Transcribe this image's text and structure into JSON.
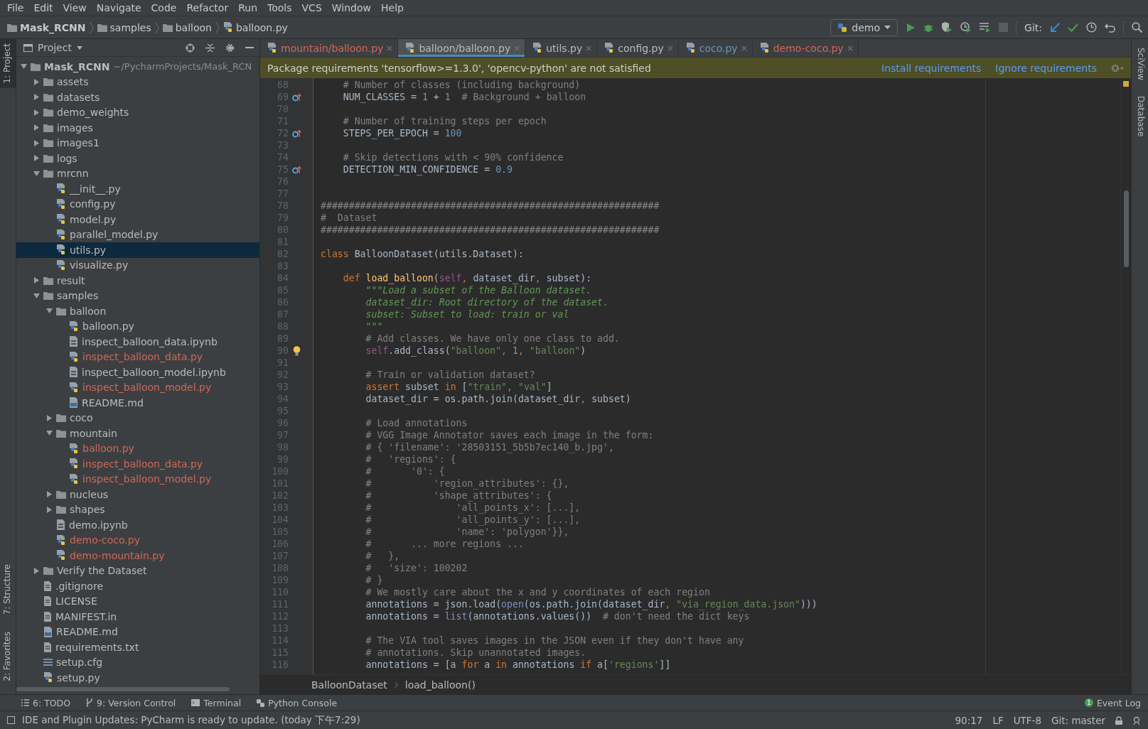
{
  "menu": [
    "File",
    "Edit",
    "View",
    "Navigate",
    "Code",
    "Refactor",
    "Run",
    "Tools",
    "VCS",
    "Window",
    "Help"
  ],
  "navbar": {
    "breadcrumbs": [
      {
        "label": "Mask_RCNN",
        "kind": "project"
      },
      {
        "label": "samples",
        "kind": "folder"
      },
      {
        "label": "balloon",
        "kind": "folder"
      },
      {
        "label": "balloon.py",
        "kind": "python"
      }
    ],
    "run_config": "demo",
    "git_label": "Git:"
  },
  "left_stripe": {
    "top": [
      {
        "label": "1: Project",
        "selected": true
      }
    ],
    "bottom": [
      {
        "label": "7: Structure",
        "selected": false
      },
      {
        "label": "2: Favorites",
        "selected": false
      }
    ]
  },
  "right_stripe": [
    "SciView",
    "Database"
  ],
  "project": {
    "title": "Project",
    "tree": [
      {
        "label": "Mask_RCNN",
        "path": "~/PycharmProjects/Mask_RCN",
        "kind": "folder",
        "expanded": true,
        "selected": false,
        "untracked": false,
        "children": [
          {
            "label": "assets",
            "kind": "folder",
            "expanded": false,
            "selected": false,
            "untracked": false
          },
          {
            "label": "datasets",
            "kind": "folder",
            "expanded": false,
            "selected": false,
            "untracked": false
          },
          {
            "label": "demo_weights",
            "kind": "folder",
            "expanded": false,
            "selected": false,
            "untracked": false
          },
          {
            "label": "images",
            "kind": "folder",
            "expanded": false,
            "selected": false,
            "untracked": false
          },
          {
            "label": "images1",
            "kind": "folder",
            "expanded": false,
            "selected": false,
            "untracked": false
          },
          {
            "label": "logs",
            "kind": "folder",
            "expanded": false,
            "selected": false,
            "untracked": false
          },
          {
            "label": "mrcnn",
            "kind": "folder",
            "expanded": true,
            "selected": false,
            "untracked": false,
            "children": [
              {
                "label": "__init__.py",
                "kind": "python",
                "selected": false,
                "untracked": false
              },
              {
                "label": "config.py",
                "kind": "python",
                "selected": false,
                "untracked": false
              },
              {
                "label": "model.py",
                "kind": "python",
                "selected": false,
                "untracked": false
              },
              {
                "label": "parallel_model.py",
                "kind": "python",
                "selected": false,
                "untracked": false
              },
              {
                "label": "utils.py",
                "kind": "python",
                "selected": true,
                "untracked": false
              },
              {
                "label": "visualize.py",
                "kind": "python",
                "selected": false,
                "untracked": false
              }
            ]
          },
          {
            "label": "result",
            "kind": "folder",
            "expanded": false,
            "selected": false,
            "untracked": false
          },
          {
            "label": "samples",
            "kind": "folder",
            "expanded": true,
            "selected": false,
            "untracked": false,
            "children": [
              {
                "label": "balloon",
                "kind": "folder",
                "expanded": true,
                "selected": false,
                "untracked": false,
                "children": [
                  {
                    "label": "balloon.py",
                    "kind": "python",
                    "selected": false,
                    "untracked": false
                  },
                  {
                    "label": "inspect_balloon_data.ipynb",
                    "kind": "notebook",
                    "selected": false,
                    "untracked": false
                  },
                  {
                    "label": "inspect_balloon_data.py",
                    "kind": "python",
                    "selected": false,
                    "untracked": true
                  },
                  {
                    "label": "inspect_balloon_model.ipynb",
                    "kind": "notebook",
                    "selected": false,
                    "untracked": false
                  },
                  {
                    "label": "inspect_balloon_model.py",
                    "kind": "python",
                    "selected": false,
                    "untracked": true
                  },
                  {
                    "label": "README.md",
                    "kind": "markdown",
                    "selected": false,
                    "untracked": false
                  }
                ]
              },
              {
                "label": "coco",
                "kind": "folder",
                "expanded": false,
                "selected": false,
                "untracked": false
              },
              {
                "label": "mountain",
                "kind": "folder",
                "expanded": true,
                "selected": false,
                "untracked": false,
                "children": [
                  {
                    "label": "balloon.py",
                    "kind": "python",
                    "selected": false,
                    "untracked": true
                  },
                  {
                    "label": "inspect_balloon_data.py",
                    "kind": "python",
                    "selected": false,
                    "untracked": true
                  },
                  {
                    "label": "inspect_balloon_model.py",
                    "kind": "python",
                    "selected": false,
                    "untracked": true
                  }
                ]
              },
              {
                "label": "nucleus",
                "kind": "folder",
                "expanded": false,
                "selected": false,
                "untracked": false
              },
              {
                "label": "shapes",
                "kind": "folder",
                "expanded": false,
                "selected": false,
                "untracked": false
              },
              {
                "label": "demo.ipynb",
                "kind": "notebook",
                "selected": false,
                "untracked": false
              },
              {
                "label": "demo-coco.py",
                "kind": "python",
                "selected": false,
                "untracked": true
              },
              {
                "label": "demo-mountain.py",
                "kind": "python",
                "selected": false,
                "untracked": true
              }
            ]
          },
          {
            "label": "Verify the Dataset",
            "kind": "folder",
            "expanded": false,
            "selected": false,
            "untracked": false
          },
          {
            "label": ".gitignore",
            "kind": "text",
            "selected": false,
            "untracked": false
          },
          {
            "label": "LICENSE",
            "kind": "text",
            "selected": false,
            "untracked": false
          },
          {
            "label": "MANIFEST.in",
            "kind": "text",
            "selected": false,
            "untracked": false
          },
          {
            "label": "README.md",
            "kind": "markdown",
            "selected": false,
            "untracked": false
          },
          {
            "label": "requirements.txt",
            "kind": "text",
            "selected": false,
            "untracked": false
          },
          {
            "label": "setup.cfg",
            "kind": "config",
            "selected": false,
            "untracked": false
          },
          {
            "label": "setup.py",
            "kind": "python",
            "selected": false,
            "untracked": false
          }
        ]
      }
    ]
  },
  "tabs": [
    {
      "label": "mountain/balloon.py",
      "untracked": true,
      "modified": false,
      "selected": false
    },
    {
      "label": "balloon/balloon.py",
      "untracked": false,
      "modified": false,
      "selected": true
    },
    {
      "label": "utils.py",
      "untracked": false,
      "modified": false,
      "selected": false
    },
    {
      "label": "config.py",
      "untracked": false,
      "modified": false,
      "selected": false
    },
    {
      "label": "coco.py",
      "untracked": false,
      "modified": true,
      "selected": false
    },
    {
      "label": "demo-coco.py",
      "untracked": true,
      "modified": false,
      "selected": false
    }
  ],
  "banner": {
    "text": "Package requirements 'tensorflow>=1.3.0', 'opencv-python' are not satisfied",
    "actions": [
      "Install requirements",
      "Ignore requirements"
    ]
  },
  "code": [
    {
      "number": "68",
      "kind": "plain",
      "tokens": [
        {
          "kind": "comment",
          "text": "    # Number of classes (including background)"
        }
      ]
    },
    {
      "number": "69",
      "kind": "override",
      "tokens": [
        {
          "kind": "text",
          "text": "    NUM_CLASSES = "
        },
        {
          "kind": "number",
          "text": "1"
        },
        {
          "kind": "text",
          "text": " + "
        },
        {
          "kind": "number",
          "text": "1"
        },
        {
          "kind": "comment",
          "text": "  # Background + balloon"
        }
      ]
    },
    {
      "number": "70",
      "kind": "plain"
    },
    {
      "number": "71",
      "kind": "plain",
      "tokens": [
        {
          "kind": "comment",
          "text": "    # Number of training steps per epoch"
        }
      ]
    },
    {
      "number": "72",
      "kind": "override",
      "tokens": [
        {
          "kind": "text",
          "text": "    STEPS_PER_EPOCH = "
        },
        {
          "kind": "number",
          "text": "100"
        }
      ]
    },
    {
      "number": "73",
      "kind": "plain"
    },
    {
      "number": "74",
      "kind": "plain",
      "tokens": [
        {
          "kind": "comment",
          "text": "    # Skip detections with < 90% confidence"
        }
      ]
    },
    {
      "number": "75",
      "kind": "override",
      "tokens": [
        {
          "kind": "text",
          "text": "    DETECTION_MIN_CONFIDENCE = "
        },
        {
          "kind": "number",
          "text": "0.9"
        }
      ]
    },
    {
      "number": "76",
      "kind": "plain"
    },
    {
      "number": "77",
      "kind": "plain"
    },
    {
      "number": "78",
      "kind": "plain",
      "tokens": [
        {
          "kind": "comment",
          "text": "############################################################"
        }
      ]
    },
    {
      "number": "79",
      "kind": "plain",
      "tokens": [
        {
          "kind": "comment",
          "text": "#  Dataset"
        }
      ]
    },
    {
      "number": "80",
      "kind": "plain",
      "tokens": [
        {
          "kind": "comment",
          "text": "############################################################"
        }
      ]
    },
    {
      "number": "81",
      "kind": "plain"
    },
    {
      "number": "82",
      "kind": "plain",
      "tokens": [
        {
          "kind": "keyword",
          "text": "class"
        },
        {
          "kind": "text",
          "text": " BalloonDataset(utils.Dataset):"
        }
      ]
    },
    {
      "number": "83",
      "kind": "plain"
    },
    {
      "number": "84",
      "kind": "plain",
      "tokens": [
        {
          "kind": "keyword",
          "text": "    def"
        },
        {
          "kind": "function",
          "text": " load_balloon"
        },
        {
          "kind": "text",
          "text": "("
        },
        {
          "kind": "self",
          "text": "self"
        },
        {
          "kind": "keyword",
          "text": ", "
        },
        {
          "kind": "text",
          "text": "dataset_dir"
        },
        {
          "kind": "keyword",
          "text": ", "
        },
        {
          "kind": "text",
          "text": "subset):"
        }
      ]
    },
    {
      "number": "85",
      "kind": "plain",
      "tokens": [
        {
          "kind": "docstring",
          "text": "        \"\"\"Load a subset of the Balloon dataset."
        }
      ]
    },
    {
      "number": "86",
      "kind": "plain",
      "tokens": [
        {
          "kind": "docstring",
          "text": "        dataset_dir: Root directory of the dataset."
        }
      ]
    },
    {
      "number": "87",
      "kind": "plain",
      "tokens": [
        {
          "kind": "docstring",
          "text": "        subset: Subset to load: train or val"
        }
      ]
    },
    {
      "number": "88",
      "kind": "plain",
      "tokens": [
        {
          "kind": "docstring",
          "text": "        \"\"\""
        }
      ]
    },
    {
      "number": "89",
      "kind": "plain",
      "tokens": [
        {
          "kind": "comment",
          "text": "        # Add classes. We have only one class to add."
        }
      ]
    },
    {
      "number": "90",
      "kind": "bulb",
      "tokens": [
        {
          "kind": "self",
          "text": "        self"
        },
        {
          "kind": "text",
          "text": ".add_class("
        },
        {
          "kind": "string",
          "text": "\"balloon\""
        },
        {
          "kind": "keyword",
          "text": ", "
        },
        {
          "kind": "number",
          "text": "1"
        },
        {
          "kind": "keyword",
          "text": ", "
        },
        {
          "kind": "string",
          "text": "\"balloon\""
        },
        {
          "kind": "text",
          "text": ")"
        }
      ]
    },
    {
      "number": "91",
      "kind": "plain"
    },
    {
      "number": "92",
      "kind": "plain",
      "tokens": [
        {
          "kind": "comment",
          "text": "        # Train or validation dataset?"
        }
      ]
    },
    {
      "number": "93",
      "kind": "plain",
      "tokens": [
        {
          "kind": "keyword",
          "text": "        assert"
        },
        {
          "kind": "text",
          "text": " subset "
        },
        {
          "kind": "keyword",
          "text": "in"
        },
        {
          "kind": "text",
          "text": " ["
        },
        {
          "kind": "string",
          "text": "\"train\""
        },
        {
          "kind": "keyword",
          "text": ", "
        },
        {
          "kind": "string",
          "text": "\"val\""
        },
        {
          "kind": "text",
          "text": "]"
        }
      ]
    },
    {
      "number": "94",
      "kind": "plain",
      "tokens": [
        {
          "kind": "text",
          "text": "        dataset_dir = os.path.join(dataset_dir"
        },
        {
          "kind": "keyword",
          "text": ", "
        },
        {
          "kind": "text",
          "text": "subset)"
        }
      ]
    },
    {
      "number": "95",
      "kind": "plain"
    },
    {
      "number": "96",
      "kind": "plain",
      "tokens": [
        {
          "kind": "comment",
          "text": "        # Load annotations"
        }
      ]
    },
    {
      "number": "97",
      "kind": "plain",
      "tokens": [
        {
          "kind": "comment",
          "text": "        # VGG Image Annotator saves each image in the form:"
        }
      ]
    },
    {
      "number": "98",
      "kind": "plain",
      "tokens": [
        {
          "kind": "comment",
          "text": "        # { 'filename': '28503151_5b5b7ec140_b.jpg',"
        }
      ]
    },
    {
      "number": "99",
      "kind": "plain",
      "tokens": [
        {
          "kind": "comment",
          "text": "        #   'regions': {"
        }
      ]
    },
    {
      "number": "100",
      "kind": "plain",
      "tokens": [
        {
          "kind": "comment",
          "text": "        #       '0': {"
        }
      ]
    },
    {
      "number": "101",
      "kind": "plain",
      "tokens": [
        {
          "kind": "comment",
          "text": "        #           'region_attributes': {},"
        }
      ]
    },
    {
      "number": "102",
      "kind": "plain",
      "tokens": [
        {
          "kind": "comment",
          "text": "        #           'shape_attributes': {"
        }
      ]
    },
    {
      "number": "103",
      "kind": "plain",
      "tokens": [
        {
          "kind": "comment",
          "text": "        #               'all_points_x': [...],"
        }
      ]
    },
    {
      "number": "104",
      "kind": "plain",
      "tokens": [
        {
          "kind": "comment",
          "text": "        #               'all_points_y': [...],"
        }
      ]
    },
    {
      "number": "105",
      "kind": "plain",
      "tokens": [
        {
          "kind": "comment",
          "text": "        #               'name': 'polygon'}},"
        }
      ]
    },
    {
      "number": "106",
      "kind": "plain",
      "tokens": [
        {
          "kind": "comment",
          "text": "        #       ... more regions ..."
        }
      ]
    },
    {
      "number": "107",
      "kind": "plain",
      "tokens": [
        {
          "kind": "comment",
          "text": "        #   },"
        }
      ]
    },
    {
      "number": "108",
      "kind": "plain",
      "tokens": [
        {
          "kind": "comment",
          "text": "        #   'size': 100202"
        }
      ]
    },
    {
      "number": "109",
      "kind": "plain",
      "tokens": [
        {
          "kind": "comment",
          "text": "        # }"
        }
      ]
    },
    {
      "number": "110",
      "kind": "plain",
      "tokens": [
        {
          "kind": "comment",
          "text": "        # We mostly care about the x and y coordinates of each region"
        }
      ]
    },
    {
      "number": "111",
      "kind": "plain",
      "tokens": [
        {
          "kind": "text",
          "text": "        annotations = json.load("
        },
        {
          "kind": "builtin",
          "text": "open"
        },
        {
          "kind": "text",
          "text": "(os.path.join(dataset_dir"
        },
        {
          "kind": "keyword",
          "text": ", "
        },
        {
          "kind": "string",
          "text": "\"via_region_data.json\""
        },
        {
          "kind": "text",
          "text": ")))"
        }
      ]
    },
    {
      "number": "112",
      "kind": "plain",
      "tokens": [
        {
          "kind": "text",
          "text": "        annotations = "
        },
        {
          "kind": "builtin",
          "text": "list"
        },
        {
          "kind": "text",
          "text": "(annotations.values())"
        },
        {
          "kind": "comment",
          "text": "  # don't need the dict keys"
        }
      ]
    },
    {
      "number": "113",
      "kind": "plain"
    },
    {
      "number": "114",
      "kind": "plain",
      "tokens": [
        {
          "kind": "comment",
          "text": "        # The VIA tool saves images in the JSON even if they don't have any"
        }
      ]
    },
    {
      "number": "115",
      "kind": "plain",
      "tokens": [
        {
          "kind": "comment",
          "text": "        # annotations. Skip unannotated images."
        }
      ]
    },
    {
      "number": "116",
      "kind": "plain",
      "tokens": [
        {
          "kind": "text",
          "text": "        annotations = [a "
        },
        {
          "kind": "keyword",
          "text": "for"
        },
        {
          "kind": "text",
          "text": " a "
        },
        {
          "kind": "keyword",
          "text": "in"
        },
        {
          "kind": "text",
          "text": " annotations "
        },
        {
          "kind": "keyword",
          "text": "if"
        },
        {
          "kind": "text",
          "text": " a["
        },
        {
          "kind": "string",
          "text": "'regions'"
        },
        {
          "kind": "text",
          "text": "]]"
        }
      ]
    }
  ],
  "breadcrumb": [
    "BalloonDataset",
    "load_balloon()"
  ],
  "tool_windows": [
    {
      "label": "6: TODO",
      "kind": "todo"
    },
    {
      "label": "9: Version Control",
      "kind": "vcs"
    },
    {
      "label": "Terminal",
      "kind": "terminal"
    },
    {
      "label": "Python Console",
      "kind": "console"
    }
  ],
  "event_log": {
    "label": "Event Log",
    "count": "1"
  },
  "status_bar": {
    "message": "IDE and Plugin Updates: PyCharm is ready to update. (today 下午7:29)",
    "position": "90:17",
    "line_separator": "LF",
    "encoding": "UTF-8",
    "branch": "Git: master"
  }
}
